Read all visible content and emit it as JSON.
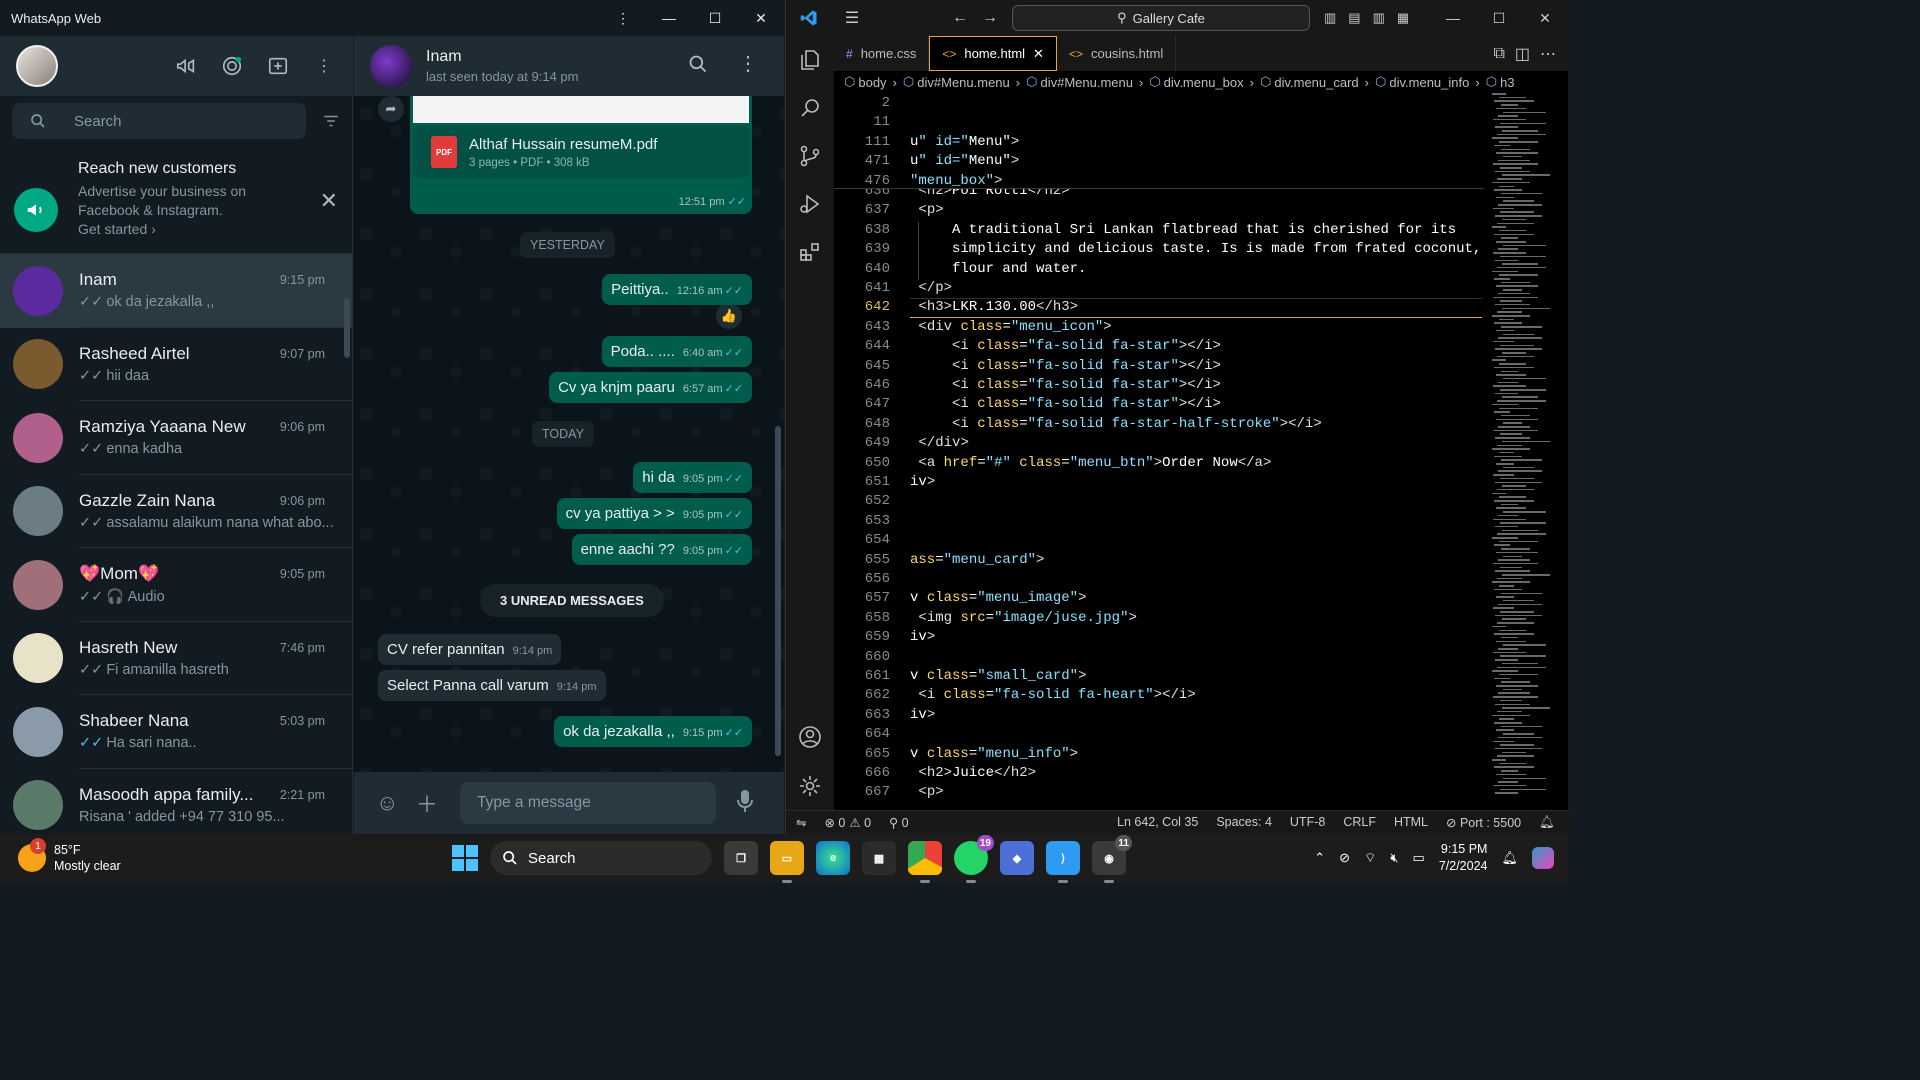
{
  "whatsapp": {
    "window_title": "WhatsApp Web",
    "search_placeholder": "Search",
    "promo": {
      "title": "Reach new customers",
      "line1": "Advertise your business on",
      "line2": "Facebook & Instagram.",
      "cta": "Get started ›"
    },
    "chats": [
      {
        "name": "Inam",
        "time": "9:15 pm",
        "last": "ok da jezakalla ,,",
        "tick": "grey",
        "active": true,
        "avatar_color": "#5b2a9e"
      },
      {
        "name": "Rasheed Airtel",
        "time": "9:07 pm",
        "last": "hii daa",
        "tick": "grey",
        "active": false,
        "avatar_color": "#7a5a2e"
      },
      {
        "name": "Ramziya Yaaana New",
        "time": "9:06 pm",
        "last": "enna kadha",
        "tick": "grey",
        "active": false,
        "avatar_color": "#b0608a"
      },
      {
        "name": "Gazzle Zain Nana",
        "time": "9:06 pm",
        "last": "assalamu alaikum nana what abo...",
        "tick": "grey",
        "active": false,
        "avatar_color": "#6b7c85"
      },
      {
        "name": "💖Mom💖",
        "time": "9:05 pm",
        "last": "🎧 Audio",
        "tick": "grey",
        "active": false,
        "avatar_color": "#a0707a"
      },
      {
        "name": "Hasreth New",
        "time": "7:46 pm",
        "last": "Fi amanilla hasreth",
        "tick": "grey",
        "active": false,
        "avatar_color": "#e8e2c8"
      },
      {
        "name": "Shabeer Nana",
        "time": "5:03 pm",
        "last": "Ha sari nana..",
        "tick": "blue",
        "active": false,
        "avatar_color": "#8a9aa8"
      },
      {
        "name": "Masoodh appa family...",
        "time": "2:21 pm",
        "last": "Risana ' added +94 77 310 95...",
        "tick": "",
        "active": false,
        "avatar_color": "#5a7a6a"
      }
    ],
    "chat": {
      "contact": "Inam",
      "status": "last seen today at 9:14 pm",
      "pdf_name": "Althaf Hussain resumeM.pdf",
      "pdf_meta": "3 pages • PDF • 308 kB",
      "pdf_label": "PDF",
      "pdf_time": "12:51 pm",
      "sep_yesterday": "YESTERDAY",
      "sep_today": "TODAY",
      "unread": "3 UNREAD MESSAGES",
      "messages": [
        {
          "text": "Peittiya..",
          "time": "12:16 am",
          "dir": "out"
        },
        {
          "text": "Poda.. ....",
          "time": "6:40 am",
          "dir": "out"
        },
        {
          "text": "Cv ya  knjm paaru",
          "time": "6:57 am",
          "dir": "out"
        },
        {
          "text": "hi da",
          "time": "9:05 pm",
          "dir": "out"
        },
        {
          "text": "cv ya pattiya > >",
          "time": "9:05 pm",
          "dir": "out"
        },
        {
          "text": "enne aachi ??",
          "time": "9:05 pm",
          "dir": "out"
        },
        {
          "text": "CV refer pannitan",
          "time": "9:14 pm",
          "dir": "in"
        },
        {
          "text": "Select Panna call varum",
          "time": "9:14 pm",
          "dir": "in"
        },
        {
          "text": "ok da jezakalla ,,",
          "time": "9:15 pm",
          "dir": "out"
        }
      ],
      "reaction": "👍",
      "input_placeholder": "Type a message"
    }
  },
  "vscode": {
    "search": "Gallery Cafe",
    "tabs": [
      {
        "label": "home.css",
        "icon": "#",
        "active": false
      },
      {
        "label": "home.html",
        "icon": "<>",
        "active": true
      },
      {
        "label": "cousins.html",
        "icon": "<>",
        "active": false
      }
    ],
    "breadcrumbs": [
      "body",
      "div#Menu.menu",
      "div#Menu.menu",
      "div.menu_box",
      "div.menu_card",
      "div.menu_info",
      "h3"
    ],
    "sticky_lines": [
      {
        "n": "2",
        "code": ""
      },
      {
        "n": "11",
        "code": ""
      },
      {
        "n": "111",
        "code": "u\" id=\"Menu\">"
      },
      {
        "n": "471",
        "code": "u\" id=\"Menu\">"
      },
      {
        "n": "476",
        "code": "\"menu_box\">"
      }
    ],
    "lines": [
      {
        "n": "636",
        "code": " <h2>Poi Rotti</h2>"
      },
      {
        "n": "637",
        "code": " <p>"
      },
      {
        "n": "638",
        "code": "     A traditional Sri Lankan flatbread that is cherished for its"
      },
      {
        "n": "639",
        "code": "     simplicity and delicious taste. Is is made from frated coconut,"
      },
      {
        "n": "640",
        "code": "     flour and water."
      },
      {
        "n": "641",
        "code": " </p>"
      },
      {
        "n": "642",
        "code": " <h3>LKR.130.00</h3>"
      },
      {
        "n": "643",
        "code": " <div class=\"menu_icon\">"
      },
      {
        "n": "644",
        "code": "     <i class=\"fa-solid fa-star\"></i>"
      },
      {
        "n": "645",
        "code": "     <i class=\"fa-solid fa-star\"></i>"
      },
      {
        "n": "646",
        "code": "     <i class=\"fa-solid fa-star\"></i>"
      },
      {
        "n": "647",
        "code": "     <i class=\"fa-solid fa-star\"></i>"
      },
      {
        "n": "648",
        "code": "     <i class=\"fa-solid fa-star-half-stroke\"></i>"
      },
      {
        "n": "649",
        "code": " </div>"
      },
      {
        "n": "650",
        "code": " <a href=\"#\" class=\"menu_btn\">Order Now</a>"
      },
      {
        "n": "651",
        "code": "iv>"
      },
      {
        "n": "652",
        "code": ""
      },
      {
        "n": "653",
        "code": ""
      },
      {
        "n": "654",
        "code": ""
      },
      {
        "n": "655",
        "code": "ass=\"menu_card\">"
      },
      {
        "n": "656",
        "code": ""
      },
      {
        "n": "657",
        "code": "v class=\"menu_image\">"
      },
      {
        "n": "658",
        "code": " <img src=\"image/juse.jpg\">"
      },
      {
        "n": "659",
        "code": "iv>"
      },
      {
        "n": "660",
        "code": ""
      },
      {
        "n": "661",
        "code": "v class=\"small_card\">"
      },
      {
        "n": "662",
        "code": " <i class=\"fa-solid fa-heart\"></i>"
      },
      {
        "n": "663",
        "code": "iv>"
      },
      {
        "n": "664",
        "code": ""
      },
      {
        "n": "665",
        "code": "v class=\"menu_info\">"
      },
      {
        "n": "666",
        "code": " <h2>Juice</h2>"
      },
      {
        "n": "667",
        "code": " <p>"
      }
    ],
    "current_line": "642",
    "status": {
      "errors": "⊗ 0",
      "warnings": "⚠ 0",
      "ports": "⚲ 0",
      "position": "Ln 642, Col 35",
      "spaces": "Spaces: 4",
      "encoding": "UTF-8",
      "eol": "CRLF",
      "language": "HTML",
      "port": "⊘ Port : 5500"
    }
  },
  "taskbar": {
    "weather_temp": "85°F",
    "weather_desc": "Mostly clear",
    "weather_badge": "1",
    "search_label": "Search",
    "whatsapp_badge": "19",
    "wa2_badge": "11",
    "time": "9:15 PM",
    "date": "7/2/2024"
  }
}
